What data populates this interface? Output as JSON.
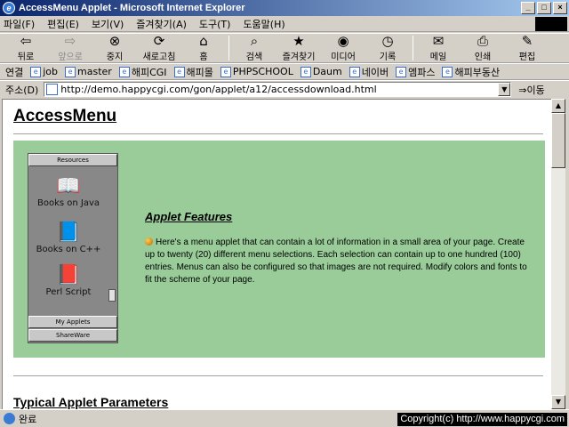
{
  "window": {
    "title": "AccessMenu Applet - Microsoft Internet Explorer"
  },
  "menubar": [
    "파일(F)",
    "편집(E)",
    "보기(V)",
    "즐겨찾기(A)",
    "도구(T)",
    "도움말(H)"
  ],
  "toolbar": {
    "back": "뒤로",
    "forward": "앞으로",
    "stop": "중지",
    "refresh": "새로고침",
    "home": "홈",
    "search": "검색",
    "favorites": "즐겨찾기",
    "media": "미디어",
    "history": "기록",
    "mail": "메일",
    "print": "인쇄",
    "edit": "편집"
  },
  "links": {
    "label": "연결",
    "items": [
      "job",
      "master",
      "해피CGI",
      "해피몰",
      "PHPSCHOOL",
      "Daum",
      "네이버",
      "엠파스",
      "해피부동산"
    ]
  },
  "address": {
    "label": "주소(D)",
    "url": "http://demo.happycgi.com/gon/applet/a12/accessdownload.html",
    "go": "이동"
  },
  "page": {
    "title": "AccessMenu",
    "applet": {
      "resources": "Resources",
      "items": [
        "Books on Java",
        "Books on C++",
        "Perl Script"
      ],
      "my_applets": "My Applets",
      "shareware": "ShareWare"
    },
    "features_heading": "Applet Features",
    "features_text": "Here's a menu applet that can contain a lot of information in a small area of your page. Create up to twenty (20) different menu selections. Each selection can contain up to one hundred (100) entries. Menus can also be configured so that images are not required. Modify colors and fonts to fit the scheme of your page.",
    "params_heading": "Typical Applet Parameters"
  },
  "status": {
    "text": "완료",
    "copyright": "Copyright(c) http://www.happycgi.com"
  },
  "colors": {
    "content_bg": "#99cc99",
    "titlebar": "#0a246a"
  }
}
